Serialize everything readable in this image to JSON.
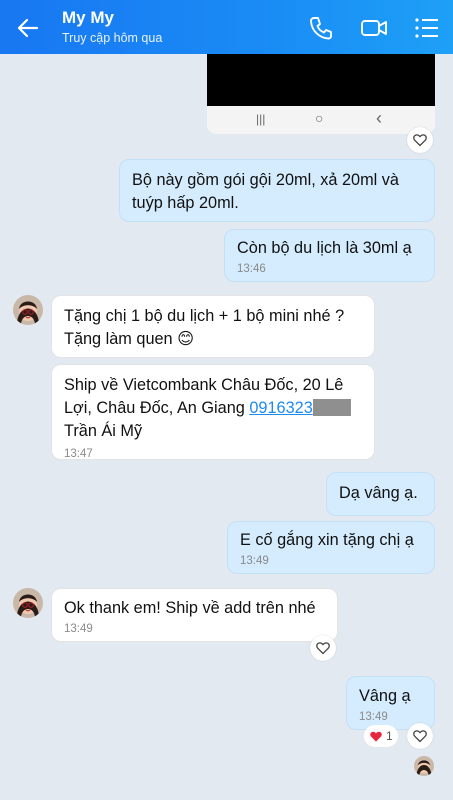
{
  "header": {
    "title": "My My",
    "subtitle": "Truy cập hôm qua"
  },
  "messages": {
    "m1": {
      "text": "Bộ này gồm gói gội 20ml, xả 20ml và tuýp hấp 20ml."
    },
    "m2": {
      "text": "Còn bộ du lịch là 30ml ạ",
      "time": "13:46"
    },
    "m3": {
      "text": "Tặng chị 1 bộ du lịch + 1 bộ mini nhé ? Tặng làm quen 😊"
    },
    "m4": {
      "text_before": "Ship về Vietcombank Châu Đốc, 20 Lê Lợi, Châu Đốc, An Giang ",
      "phone": "0916323",
      "text_after": "Trần Ái Mỹ",
      "time": "13:47"
    },
    "m5": {
      "text": "Dạ vâng ạ."
    },
    "m6": {
      "text": "E cố gắng xin tặng chị ạ",
      "time": "13:49"
    },
    "m7": {
      "text": "Ok thank em! Ship về add trên nhé",
      "time": "13:49"
    },
    "m8": {
      "text": "Vâng ạ",
      "time": "13:49",
      "reaction_count": "1"
    }
  },
  "image_nav": {
    "recent": "|||",
    "home": "○",
    "back": "‹"
  },
  "colors": {
    "header": "#1877f2",
    "me_bubble": "#d4ecfd",
    "other_bubble": "#ffffff",
    "background": "#e2e9f1",
    "link": "#1d8af0"
  },
  "icons": [
    "back-arrow-icon",
    "phone-icon",
    "video-call-icon",
    "menu-icon",
    "heart-outline-icon",
    "heart-icon"
  ]
}
